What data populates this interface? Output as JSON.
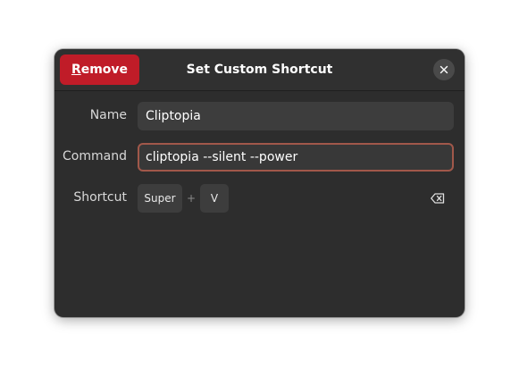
{
  "dialog": {
    "title": "Set Custom Shortcut",
    "remove_button": {
      "mnemonic": "R",
      "rest": "emove"
    },
    "close_icon": "close-icon",
    "fields": {
      "name": {
        "label": "Name",
        "value": "Cliptopia"
      },
      "command": {
        "label": "Command",
        "value": "cliptopia --silent --power"
      }
    },
    "shortcut": {
      "label": "Shortcut",
      "keys": [
        "Super",
        "V"
      ],
      "separator": "+",
      "clear_icon": "backspace-icon"
    }
  },
  "colors": {
    "destructive": "#c01c28",
    "dialog_bg": "#2d2d2d",
    "entry_bg": "#3d3d3d",
    "focus_border": "#a1584a"
  }
}
